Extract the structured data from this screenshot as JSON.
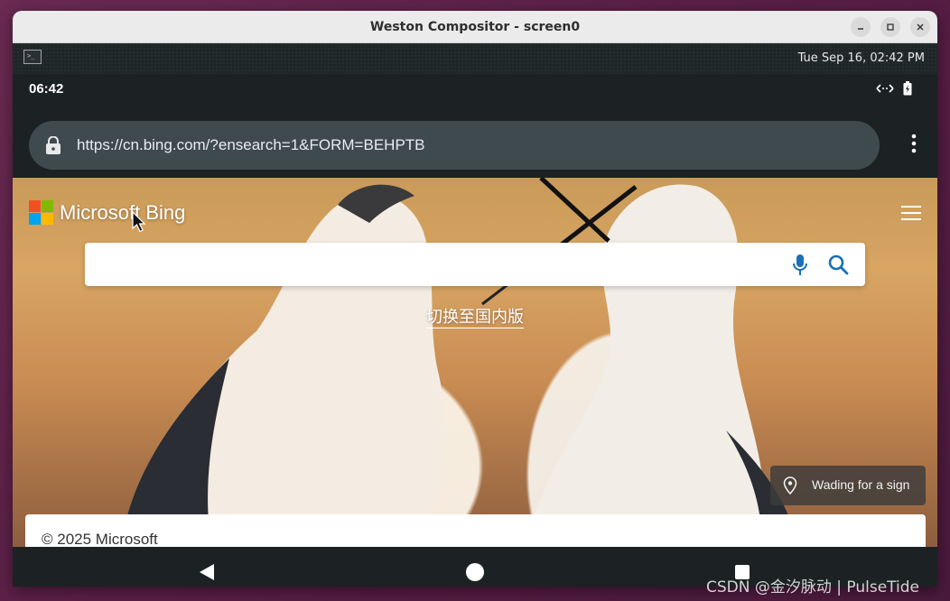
{
  "window": {
    "title": "Weston Compositor - screen0",
    "minimize_icon": "minimize-icon",
    "maximize_icon": "maximize-icon",
    "close_icon": "close-icon"
  },
  "panel": {
    "launcher_icon": "terminal-icon",
    "clock": "Tue Sep 16, 02:42 PM"
  },
  "android": {
    "status_time": "06:42",
    "status_icons": [
      "ethernet-icon",
      "battery-icon"
    ],
    "nav": [
      "back-icon",
      "home-icon",
      "recents-icon"
    ]
  },
  "browser": {
    "url": "https://cn.bing.com/?ensearch=1&FORM=BEHPTB",
    "lock_icon": "lock-icon",
    "menu_icon": "overflow-menu-icon"
  },
  "bing": {
    "brand": "Microsoft Bing",
    "search_placeholder": "",
    "switch_link": "切换至国内版",
    "location_label": "Wading for a sign",
    "footer": "© 2025 Microsoft"
  },
  "colors": {
    "ms_red": "#F25022",
    "ms_green": "#7FBA00",
    "ms_blue": "#00A4EF",
    "ms_yellow": "#FFB900",
    "bing_accent": "#1a6fb5",
    "url_bar": "#3f4a4f"
  },
  "watermark": "CSDN @金汐脉动 | PulseTide"
}
